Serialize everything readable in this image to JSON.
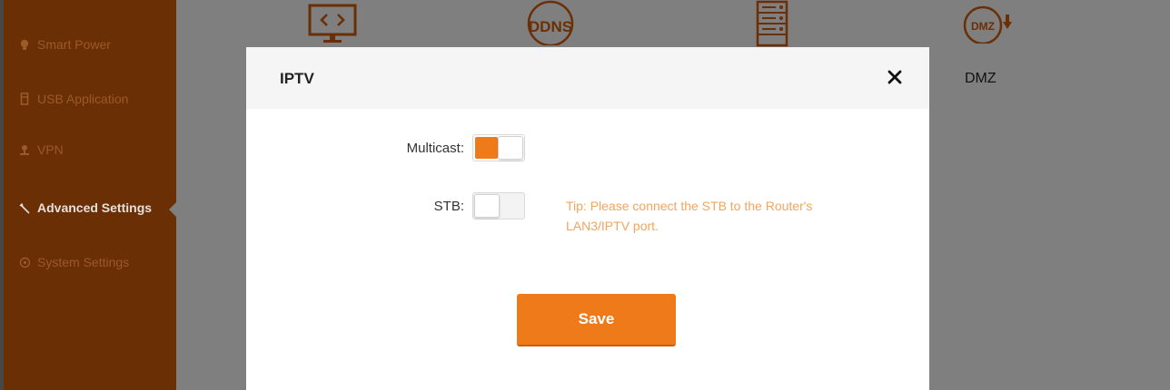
{
  "sidebar": {
    "items": [
      {
        "label": "Smart Power",
        "icon": "bulb-icon"
      },
      {
        "label": "USB Application",
        "icon": "usb-icon"
      },
      {
        "label": "VPN",
        "icon": "person-icon"
      },
      {
        "label": "Advanced Settings",
        "icon": "wrench-icon",
        "active": true
      },
      {
        "label": "System Settings",
        "icon": "gear-icon"
      }
    ]
  },
  "background": {
    "icons": [
      "remote-display-icon",
      "ddns-icon",
      "server-icon",
      "dmz-icon"
    ],
    "ddns_text": "DDNS",
    "dmz_icon_text": "DMZ",
    "dmz_label": "DMZ"
  },
  "modal": {
    "title": "IPTV",
    "multicast": {
      "label": "Multicast:",
      "enabled": true
    },
    "stb": {
      "label": "STB:",
      "enabled": false,
      "tip": "Tip: Please connect the STB to the Router's LAN3/IPTV port."
    },
    "save_label": "Save"
  },
  "colors": {
    "accent": "#ee7a1a",
    "sidebar": "#6a2f04",
    "overlay": "#7f7f7f",
    "tip": "#f2a55d"
  }
}
